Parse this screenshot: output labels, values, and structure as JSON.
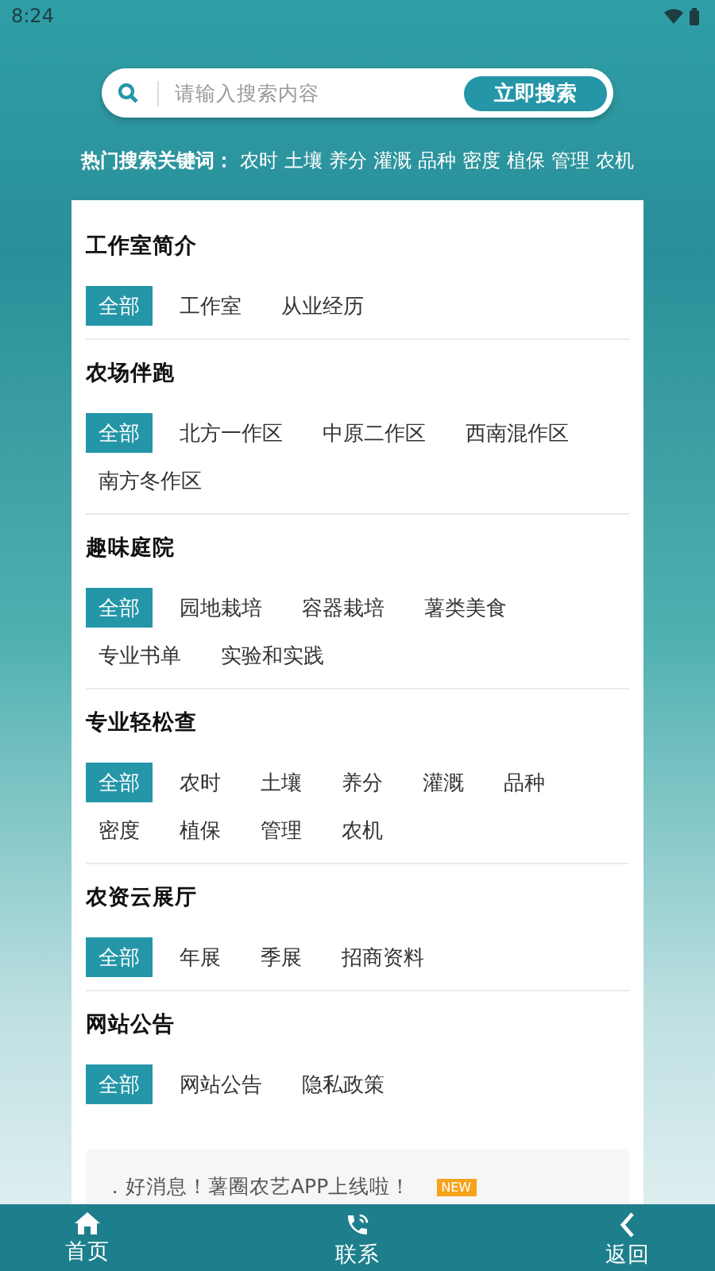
{
  "status_bar": {
    "time": "8:24"
  },
  "search": {
    "placeholder": "请输入搜索内容",
    "button": "立即搜索"
  },
  "hot_keywords": {
    "label": "热门搜索关键词：",
    "items": [
      "农时",
      "土壤",
      "养分",
      "灌溉",
      "品种",
      "密度",
      "植保",
      "管理",
      "农机"
    ]
  },
  "sections": [
    {
      "title": "工作室简介",
      "chips": [
        {
          "label": "全部",
          "selected": true
        },
        {
          "label": "工作室",
          "selected": false
        },
        {
          "label": "从业经历",
          "selected": false
        }
      ]
    },
    {
      "title": "农场伴跑",
      "chips": [
        {
          "label": "全部",
          "selected": true
        },
        {
          "label": "北方一作区",
          "selected": false
        },
        {
          "label": "中原二作区",
          "selected": false
        },
        {
          "label": "西南混作区",
          "selected": false
        },
        {
          "label": "南方冬作区",
          "selected": false
        }
      ]
    },
    {
      "title": "趣味庭院",
      "chips": [
        {
          "label": "全部",
          "selected": true
        },
        {
          "label": "园地栽培",
          "selected": false
        },
        {
          "label": "容器栽培",
          "selected": false
        },
        {
          "label": "薯类美食",
          "selected": false
        },
        {
          "label": "专业书单",
          "selected": false
        },
        {
          "label": "实验和实践",
          "selected": false
        }
      ]
    },
    {
      "title": "专业轻松查",
      "chips": [
        {
          "label": "全部",
          "selected": true
        },
        {
          "label": "农时",
          "selected": false
        },
        {
          "label": "土壤",
          "selected": false
        },
        {
          "label": "养分",
          "selected": false
        },
        {
          "label": "灌溉",
          "selected": false
        },
        {
          "label": "品种",
          "selected": false
        },
        {
          "label": "密度",
          "selected": false
        },
        {
          "label": "植保",
          "selected": false
        },
        {
          "label": "管理",
          "selected": false
        },
        {
          "label": "农机",
          "selected": false
        }
      ]
    },
    {
      "title": "农资云展厅",
      "chips": [
        {
          "label": "全部",
          "selected": true
        },
        {
          "label": "年展",
          "selected": false
        },
        {
          "label": "季展",
          "selected": false
        },
        {
          "label": "招商资料",
          "selected": false
        }
      ]
    },
    {
      "title": "网站公告",
      "chips": [
        {
          "label": "全部",
          "selected": true
        },
        {
          "label": "网站公告",
          "selected": false
        },
        {
          "label": "隐私政策",
          "selected": false
        }
      ]
    }
  ],
  "notice": {
    "text": "．好消息！薯圈农艺APP上线啦！",
    "badge": "NEW"
  },
  "nav": [
    {
      "kind": "home",
      "label": "首页"
    },
    {
      "kind": "phone",
      "label": "联系"
    },
    {
      "kind": "back",
      "label": "返回"
    }
  ]
}
